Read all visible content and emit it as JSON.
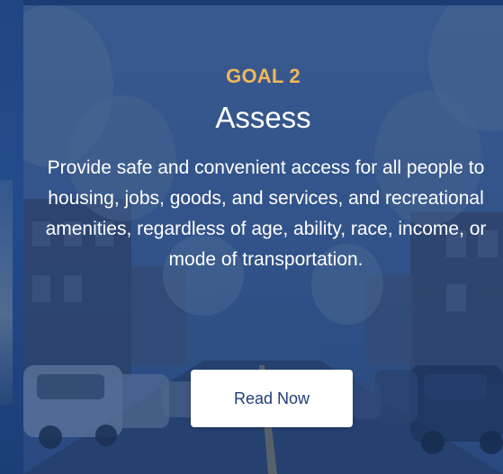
{
  "card": {
    "goal_label": "GOAL 2",
    "title": "Assess",
    "description": "Provide safe and convenient access for all people to housing, jobs, goods, and services, and recreational amenities, regardless of age, ability, race, income, or mode of transportation.",
    "button_label": "Read Now"
  },
  "colors": {
    "accent": "#f2b75a",
    "overlay": "#1e407d",
    "button_bg": "#ffffff",
    "button_text": "#1f3f78"
  }
}
